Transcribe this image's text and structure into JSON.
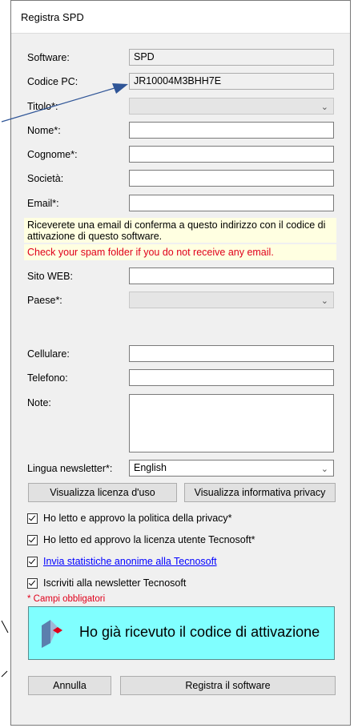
{
  "window": {
    "title": "Registra SPD"
  },
  "fields": {
    "software": {
      "label": "Software:",
      "value": "SPD"
    },
    "codice_pc": {
      "label": "Codice PC:",
      "value": "JR10004M3BHH7E"
    },
    "titolo": {
      "label": "Titolo*:",
      "value": ""
    },
    "nome": {
      "label": "Nome*:",
      "value": ""
    },
    "cognome": {
      "label": "Cognome*:",
      "value": ""
    },
    "societa": {
      "label": "Società:",
      "value": ""
    },
    "email": {
      "label": "Email*:",
      "value": ""
    },
    "sito_web": {
      "label": "Sito WEB:",
      "value": ""
    },
    "paese": {
      "label": "Paese*:",
      "value": ""
    },
    "cellulare": {
      "label": "Cellulare:",
      "value": ""
    },
    "telefono": {
      "label": "Telefono:",
      "value": ""
    },
    "note": {
      "label": "Note:",
      "value": ""
    },
    "lingua": {
      "label": "Lingua newsletter*:",
      "value": "English"
    }
  },
  "email_info": "Riceverete una email di conferma a questo indirizzo con il codice di attivazione di questo software.",
  "spam_warning": "Check your spam folder if you do not receive any email.",
  "buttons": {
    "licenza": "Visualizza licenza d'uso",
    "privacy": "Visualizza informativa privacy",
    "annulla": "Annulla",
    "registra": "Registra il software"
  },
  "checkboxes": [
    {
      "label": "Ho letto e approvo la politica della privacy*",
      "checked": true
    },
    {
      "label": "Ho letto ed approvo la licenza utente Tecnosoft*",
      "checked": true
    },
    {
      "label": "Invia statistiche anonime alla Tecnosoft",
      "checked": true
    },
    {
      "label": "Iscriviti alla newsletter Tecnosoft",
      "checked": true
    }
  ],
  "required_note": "* Campi obbligatori",
  "activation_button": "Ho già ricevuto il codice di attivazione",
  "colors": {
    "activation_bg": "#80ffff",
    "link": "#0000ff",
    "warning": "#e0001b",
    "info_bg": "#ffffe1"
  }
}
